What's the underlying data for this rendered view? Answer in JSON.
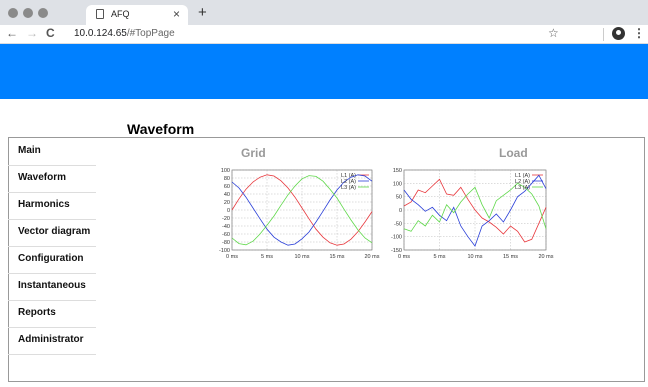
{
  "browser": {
    "tab_title": "AFQ",
    "tab_close": "×",
    "new_tab": "+",
    "url_host": "10.0.124.65",
    "url_path": "/#TopPage",
    "back": "←",
    "forward": "→",
    "reload": "C",
    "star": "☆",
    "menu": "⋮"
  },
  "page": {
    "title": "Waveform",
    "banner_color": "#0080ff"
  },
  "sidebar": {
    "items": [
      {
        "label": "Main"
      },
      {
        "label": "Waveform"
      },
      {
        "label": "Harmonics"
      },
      {
        "label": "Vector diagram"
      },
      {
        "label": "Configuration"
      },
      {
        "label": "Instantaneous"
      },
      {
        "label": "Reports"
      },
      {
        "label": "Administrator"
      }
    ]
  },
  "chart_data": [
    {
      "type": "line",
      "title": "Grid",
      "x_ticks": [
        "0 ms",
        "5 ms",
        "10 ms",
        "15 ms",
        "20 ms"
      ],
      "xlim": [
        0,
        20
      ],
      "ylim": [
        -100,
        100
      ],
      "y_ticks": [
        -100,
        -80,
        -60,
        -40,
        -20,
        0,
        20,
        40,
        60,
        80,
        100
      ],
      "grid": true,
      "legend": "top-right",
      "series": [
        {
          "name": "L1 (A)",
          "color": "#e8383d",
          "x": [
            0,
            1,
            2,
            3,
            4,
            5,
            6,
            7,
            8,
            9,
            10,
            11,
            12,
            13,
            14,
            15,
            16,
            17,
            18,
            19,
            20
          ],
          "values": [
            0,
            28,
            52,
            70,
            82,
            88,
            85,
            73,
            55,
            32,
            5,
            -22,
            -48,
            -68,
            -82,
            -88,
            -85,
            -73,
            -54,
            -30,
            -4
          ]
        },
        {
          "name": "L2 (A)",
          "color": "#2a3fd8",
          "x": [
            0,
            1,
            2,
            3,
            4,
            5,
            6,
            7,
            8,
            9,
            10,
            11,
            12,
            13,
            14,
            15,
            16,
            17,
            18,
            19,
            20
          ],
          "values": [
            70,
            55,
            32,
            5,
            -22,
            -48,
            -68,
            -80,
            -88,
            -85,
            -72,
            -55,
            -30,
            -3,
            25,
            50,
            70,
            82,
            88,
            85,
            72
          ]
        },
        {
          "name": "L3 (A)",
          "color": "#5fd84a",
          "x": [
            0,
            1,
            2,
            3,
            4,
            5,
            6,
            7,
            8,
            9,
            10,
            11,
            12,
            13,
            14,
            15,
            16,
            17,
            18,
            19,
            20
          ],
          "values": [
            -70,
            -84,
            -87,
            -78,
            -60,
            -38,
            -15,
            12,
            38,
            60,
            78,
            86,
            84,
            72,
            52,
            30,
            2,
            -25,
            -50,
            -70,
            -82
          ]
        }
      ]
    },
    {
      "type": "line",
      "title": "Load",
      "x_ticks": [
        "0 ms",
        "5 ms",
        "10 ms",
        "15 ms",
        "20 ms"
      ],
      "xlim": [
        0,
        20
      ],
      "ylim": [
        -150,
        150
      ],
      "y_ticks": [
        -150,
        -100,
        -50,
        0,
        50,
        100,
        150
      ],
      "grid": true,
      "legend": "top-right",
      "series": [
        {
          "name": "L1 (A)",
          "color": "#e8383d",
          "x": [
            0,
            1,
            2,
            3,
            4,
            5,
            6,
            7,
            8,
            9,
            10,
            11,
            12,
            13,
            14,
            15,
            16,
            17,
            18,
            19,
            20
          ],
          "values": [
            15,
            30,
            75,
            65,
            90,
            115,
            60,
            55,
            85,
            40,
            0,
            -30,
            -45,
            -65,
            -90,
            -60,
            -80,
            -120,
            -110,
            -50,
            10
          ]
        },
        {
          "name": "L2 (A)",
          "color": "#2a3fd8",
          "x": [
            0,
            1,
            2,
            3,
            4,
            5,
            6,
            7,
            8,
            9,
            10,
            11,
            12,
            13,
            14,
            15,
            16,
            17,
            18,
            19,
            20
          ],
          "values": [
            75,
            40,
            20,
            -5,
            10,
            -20,
            -40,
            10,
            -60,
            -100,
            -135,
            -60,
            -40,
            -15,
            -45,
            0,
            50,
            70,
            100,
            130,
            80
          ]
        },
        {
          "name": "L3 (A)",
          "color": "#5fd84a",
          "x": [
            0,
            1,
            2,
            3,
            4,
            5,
            6,
            7,
            8,
            9,
            10,
            11,
            12,
            13,
            14,
            15,
            16,
            17,
            18,
            19,
            20
          ],
          "values": [
            -70,
            -80,
            -40,
            -60,
            -20,
            -45,
            20,
            -10,
            30,
            60,
            85,
            20,
            -30,
            35,
            55,
            75,
            100,
            85,
            60,
            15,
            -70
          ]
        }
      ]
    }
  ]
}
